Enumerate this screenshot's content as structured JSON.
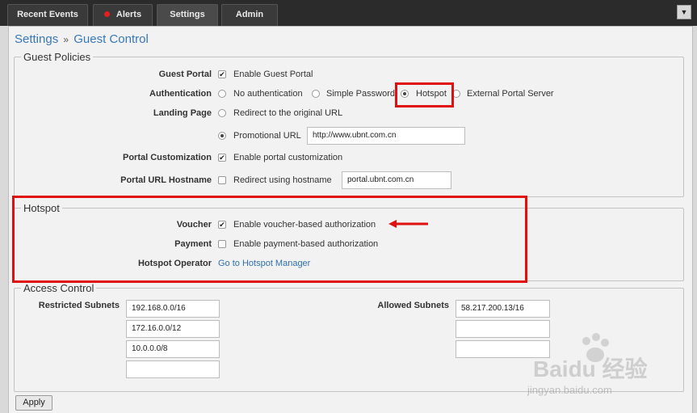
{
  "tabs": [
    {
      "label": "Recent Events",
      "active": false
    },
    {
      "label": "Alerts",
      "active": false,
      "indicator_color": "#e51f1f"
    },
    {
      "label": "Settings",
      "active": true
    },
    {
      "label": "Admin",
      "active": false
    }
  ],
  "menu_icon": "chevron-down-icon",
  "breadcrumb": {
    "root": "Settings",
    "separator": "»",
    "current": "Guest Control"
  },
  "guest_policies": {
    "legend": "Guest Policies",
    "guest_portal": {
      "label": "Guest Portal",
      "option": "Enable Guest Portal",
      "checked": true
    },
    "authentication": {
      "label": "Authentication",
      "options": [
        "No authentication",
        "Simple Password",
        "Hotspot",
        "External Portal Server"
      ],
      "selected": "Hotspot"
    },
    "landing_page": {
      "label": "Landing Page",
      "option_redirect": "Redirect to the original URL",
      "option_promo": "Promotional URL",
      "promo_url": "http://www.ubnt.com.cn",
      "selected": "Promotional URL"
    },
    "portal_customization": {
      "label": "Portal Customization",
      "option": "Enable portal customization",
      "checked": true
    },
    "portal_url_hostname": {
      "label": "Portal URL Hostname",
      "option": "Redirect using hostname",
      "checked": false,
      "hostname": "portal.ubnt.com.cn"
    }
  },
  "hotspot": {
    "legend": "Hotspot",
    "voucher": {
      "label": "Voucher",
      "option": "Enable voucher-based authorization",
      "checked": true
    },
    "payment": {
      "label": "Payment",
      "option": "Enable payment-based authorization",
      "checked": false
    },
    "operator": {
      "label": "Hotspot Operator",
      "link": "Go to Hotspot Manager"
    }
  },
  "access_control": {
    "legend": "Access Control",
    "restricted_label": "Restricted Subnets",
    "restricted": [
      "192.168.0.0/16",
      "172.16.0.0/12",
      "10.0.0.0/8",
      ""
    ],
    "allowed_label": "Allowed Subnets",
    "allowed": [
      "58.217.200.13/16",
      "",
      ""
    ]
  },
  "apply_label": "Apply",
  "annotation_color": "#e01010",
  "watermark": {
    "logo": "Baidu 经验",
    "sub": "jingyan.baidu.com"
  }
}
